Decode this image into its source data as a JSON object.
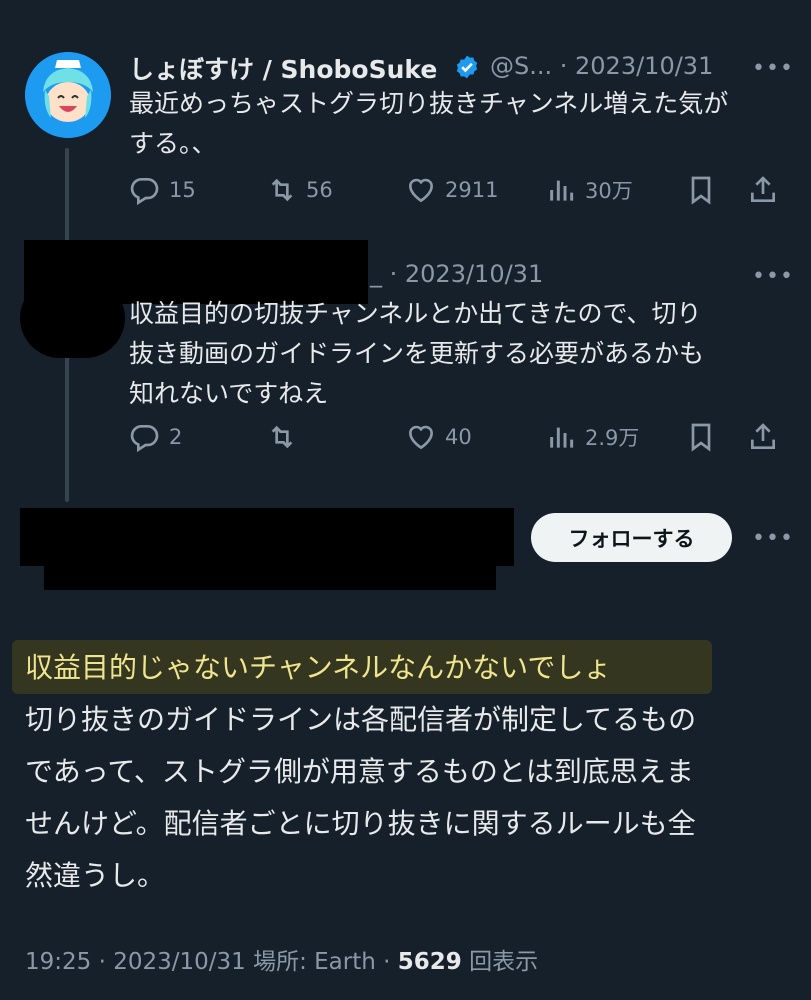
{
  "tweet1": {
    "name": "しょぼすけ / ShoboSuke",
    "handle_date": "@S... · 2023/10/31",
    "text_lines": [
      "最近めっちゃストグラ切り抜きチャンネル増えた気が",
      "する。、"
    ],
    "replies": "15",
    "retweets": "56",
    "likes": "2911",
    "views": "30万"
  },
  "tweet2": {
    "date": "_ · 2023/10/31",
    "text_lines": [
      "収益目的の切抜チャンネルとか出てきたので、切り",
      "抜き動画のガイドラインを更新する必要があるかも",
      "知れないですねえ"
    ],
    "replies": "2",
    "likes": "40",
    "views": "2.9万"
  },
  "follow_label": "フォローする",
  "main": {
    "highlight_line": "収益目的じゃないチャンネルなんかないでしょ",
    "lines": [
      "切り抜きのガイドラインは各配信者が制定してるもの",
      "であって、ストグラ側が用意するものとは到底思えま",
      "せんけど。配信者ごとに切り抜きに関するルールも全",
      "然違うし。"
    ]
  },
  "footer": {
    "meta": "19:25 · 2023/10/31 場所: Earth · ",
    "view_count": "5629",
    "view_label": " 回表示"
  },
  "more_glyph": "•••",
  "colors": {
    "accent": "#1d9bf0",
    "highlight_bg": "#35361f",
    "highlight_text": "#f0e58f"
  }
}
